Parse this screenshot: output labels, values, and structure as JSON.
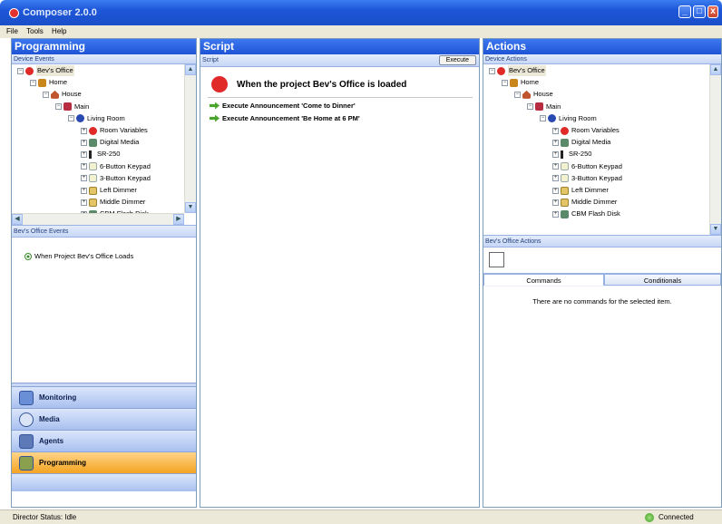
{
  "window": {
    "title": "Composer 2.0.0"
  },
  "menu": [
    "File",
    "Tools",
    "Help"
  ],
  "programming": {
    "header": "Programming",
    "device_events_label": "Device Events",
    "events_label": "Bev's Office Events",
    "event_item": "When Project Bev's Office Loads"
  },
  "tree": [
    {
      "label": "Bev's Office",
      "icon": "red-logo-icon",
      "depth": 0
    },
    {
      "label": "Home",
      "icon": "home-icon",
      "depth": 1
    },
    {
      "label": "House",
      "icon": "house-icon",
      "depth": 2
    },
    {
      "label": "Main",
      "icon": "floor-icon",
      "depth": 3
    },
    {
      "label": "Living Room",
      "icon": "room-icon",
      "depth": 4
    },
    {
      "label": "Room Variables",
      "icon": "red-logo-icon",
      "depth": 5
    },
    {
      "label": "Digital Media",
      "icon": "media-icon",
      "depth": 5
    },
    {
      "label": "SR-250",
      "icon": "remote-icon",
      "depth": 5
    },
    {
      "label": "6-Button Keypad",
      "icon": "keypad-icon",
      "depth": 5
    },
    {
      "label": "3-Button Keypad",
      "icon": "keypad-icon",
      "depth": 5
    },
    {
      "label": "Left Dimmer",
      "icon": "dimmer-icon",
      "depth": 5
    },
    {
      "label": "Middle Dimmer",
      "icon": "dimmer-icon",
      "depth": 5
    },
    {
      "label": "CBM Flash Disk",
      "icon": "media-icon",
      "depth": 5
    }
  ],
  "nav": {
    "monitoring": "Monitoring",
    "media": "Media",
    "agents": "Agents",
    "programming": "Programming"
  },
  "script": {
    "header": "Script",
    "sub_label": "Script",
    "execute_button": "Execute",
    "heading": "When the project Bev's Office is loaded",
    "commands": [
      "Execute Announcement 'Come to Dinner'",
      "Execute Announcement 'Be Home at 6 PM'"
    ]
  },
  "actions": {
    "header": "Actions",
    "device_actions_label": "Device Actions",
    "office_actions_label": "Bev's Office Actions",
    "tabs": [
      "Commands",
      "Conditionals"
    ],
    "empty_message": "There are no commands for the selected item."
  },
  "status": {
    "director": "Director Status: Idle",
    "connection": "Connected"
  }
}
